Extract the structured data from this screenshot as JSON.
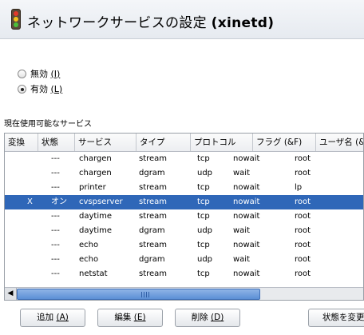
{
  "window": {
    "title_main": "ネットワークサービスの設定",
    "title_paren": "(xinetd)"
  },
  "radios": [
    {
      "label": "無効",
      "accel": "(I)",
      "selected": false
    },
    {
      "label": "有効",
      "accel": "(L)",
      "selected": true
    }
  ],
  "section_label": "現在使用可能なサービス",
  "table": {
    "columns": [
      "変換",
      "状態",
      "サービス",
      "タイプ",
      "プロトコル",
      "フラグ (&F)",
      "ユーザ名 (&)"
    ],
    "rows": [
      {
        "change": "",
        "status": "---",
        "service": "chargen",
        "type": "stream",
        "protocol": "tcp",
        "flags": "nowait",
        "user": "root",
        "selected": false
      },
      {
        "change": "",
        "status": "---",
        "service": "chargen",
        "type": "dgram",
        "protocol": "udp",
        "flags": "wait",
        "user": "root",
        "selected": false
      },
      {
        "change": "",
        "status": "---",
        "service": "printer",
        "type": "stream",
        "protocol": "tcp",
        "flags": "nowait",
        "user": "lp",
        "selected": false
      },
      {
        "change": "X",
        "status": "オン",
        "service": "cvspserver",
        "type": "stream",
        "protocol": "tcp",
        "flags": "nowait",
        "user": "root",
        "selected": true
      },
      {
        "change": "",
        "status": "---",
        "service": "daytime",
        "type": "stream",
        "protocol": "tcp",
        "flags": "nowait",
        "user": "root",
        "selected": false
      },
      {
        "change": "",
        "status": "---",
        "service": "daytime",
        "type": "dgram",
        "protocol": "udp",
        "flags": "wait",
        "user": "root",
        "selected": false
      },
      {
        "change": "",
        "status": "---",
        "service": "echo",
        "type": "stream",
        "protocol": "tcp",
        "flags": "nowait",
        "user": "root",
        "selected": false
      },
      {
        "change": "",
        "status": "---",
        "service": "echo",
        "type": "dgram",
        "protocol": "udp",
        "flags": "wait",
        "user": "root",
        "selected": false
      },
      {
        "change": "",
        "status": "---",
        "service": "netstat",
        "type": "stream",
        "protocol": "tcp",
        "flags": "nowait",
        "user": "root",
        "selected": false
      }
    ]
  },
  "buttons": {
    "add": {
      "label": "追加",
      "accel": "(A)"
    },
    "edit": {
      "label": "編集",
      "accel": "(E)"
    },
    "delete": {
      "label": "削除",
      "accel": "(D)"
    },
    "toggle": {
      "label": "状態を変更"
    }
  },
  "colors": {
    "selection": "#2f67b8",
    "scroll_thumb": "#5b8fd6"
  },
  "icons": {
    "title_icon": "traffic-light-icon",
    "scroll_left": "left-arrow-icon"
  }
}
